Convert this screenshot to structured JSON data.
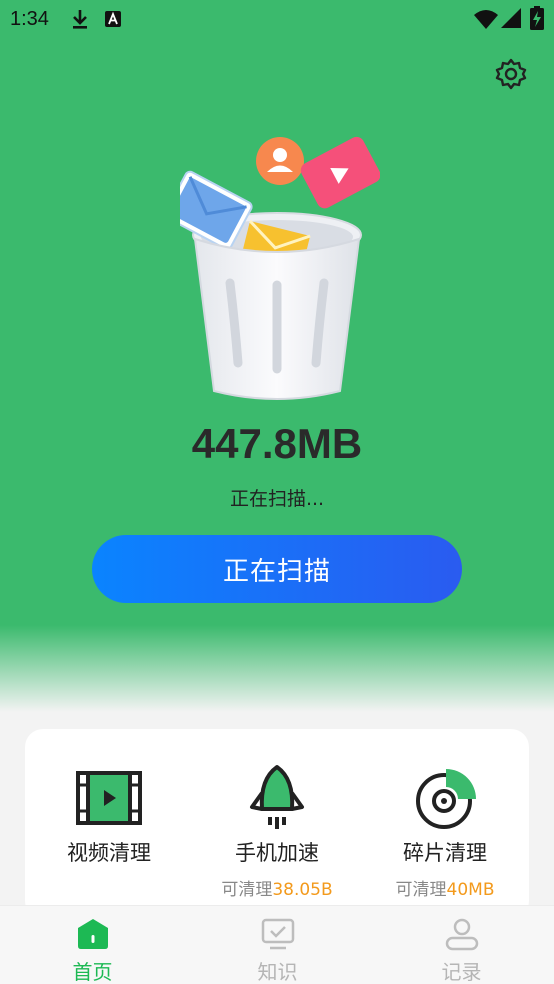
{
  "status_bar": {
    "time": "1:34",
    "icons": [
      "download-icon",
      "a-notification-icon",
      "wifi-icon",
      "signal-icon",
      "battery-charging-icon"
    ]
  },
  "header": {
    "settings_icon": "gear-icon"
  },
  "scan": {
    "size": "447.8MB",
    "status": "正在扫描...",
    "button_label": "正在扫描"
  },
  "tools": [
    {
      "icon": "video-icon",
      "name": "视频清理",
      "sub_prefix": "",
      "sub_amount": ""
    },
    {
      "icon": "rocket-icon",
      "name": "手机加速",
      "sub_prefix": "可清理",
      "sub_amount": "38.05B"
    },
    {
      "icon": "disk-icon",
      "name": "碎片清理",
      "sub_prefix": "可清理",
      "sub_amount": "40MB"
    }
  ],
  "nav": [
    {
      "icon": "home-icon",
      "label": "首页",
      "active": true
    },
    {
      "icon": "knowledge-icon",
      "label": "知识",
      "active": false
    },
    {
      "icon": "records-icon",
      "label": "记录",
      "active": false
    }
  ],
  "colors": {
    "hero_green": "#3bba6d",
    "button_blue": "#0a84ff",
    "accent_orange": "#f39a1c",
    "nav_active": "#1db954"
  }
}
